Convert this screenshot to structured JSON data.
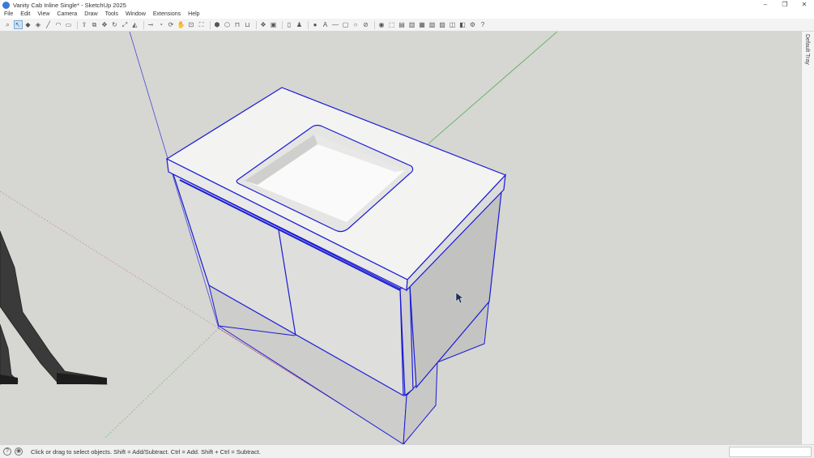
{
  "window": {
    "title": "Vanity Cab Inline Single* - SketchUp 2025",
    "controls": [
      "–",
      "❐",
      "✕"
    ]
  },
  "menu": [
    "File",
    "Edit",
    "View",
    "Camera",
    "Draw",
    "Tools",
    "Window",
    "Extensions",
    "Help"
  ],
  "toolbar": {
    "groups": [
      [
        "zoom-icon",
        "select-icon",
        "eraser-icon",
        "paint-bucket-icon",
        "pencil-line-icon",
        "arc-icon",
        "rectangle-icon"
      ],
      [
        "push-pull-icon",
        "offset-icon",
        "move-icon",
        "rotate-icon",
        "scale-icon",
        "follow-me-icon"
      ],
      [
        "tape-measure-icon",
        "protractor-icon",
        "orbit-icon",
        "pan-icon",
        "zoom-window-icon",
        "zoom-extents-icon"
      ],
      [
        "solid-tools-icon",
        "outer-shell-icon",
        "intersect-icon",
        "union-icon"
      ],
      [
        "component-icon",
        "group-icon"
      ],
      [
        "new-file-icon",
        "user-icon"
      ],
      [
        "point-icon",
        "text-icon",
        "dimension-icon",
        "section-icon",
        "circle-icon",
        "hide-icon"
      ],
      [
        "extension-icon",
        "iso-view-icon",
        "top-view-icon",
        "front-view-icon",
        "right-view-icon",
        "back-view-icon",
        "left-view-icon",
        "perspective-icon",
        "shaded-icon",
        "settings-icon",
        "help-icon"
      ]
    ]
  },
  "tray": {
    "label": "Default Tray"
  },
  "status": {
    "help_icon": "?",
    "geo_icon": "◉",
    "message": "Click or drag to select objects. Shift = Add/Subtract. Ctrl = Add. Shift + Ctrl = Subtract."
  },
  "measurements": {
    "value": ""
  },
  "colors": {
    "selection": "#1a1ad6",
    "axis_green": "#4caf50",
    "axis_blue": "#4a4ad0",
    "axis_red": "#c46060",
    "background": "#d6d6d3"
  }
}
